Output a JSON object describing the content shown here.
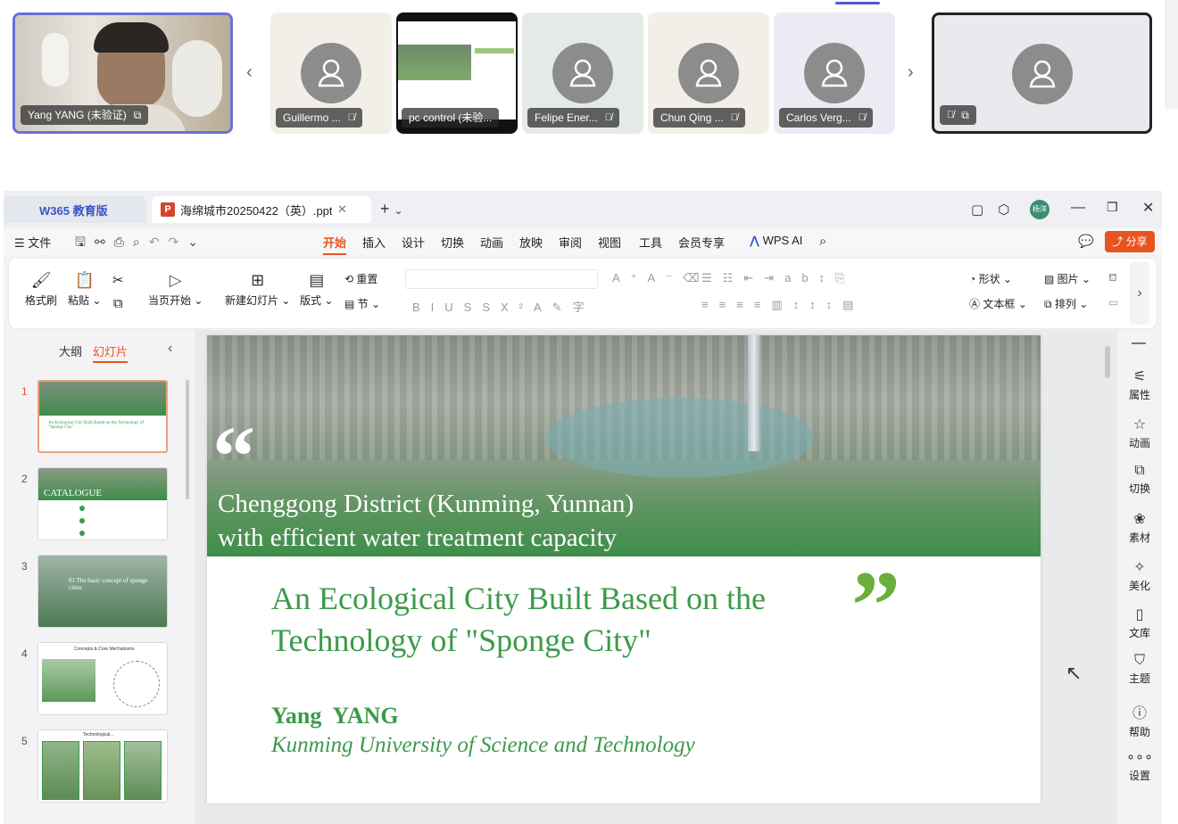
{
  "participants": [
    {
      "name": "Yang YANG (未验证)",
      "mic": "on"
    },
    {
      "name": "Guillermo ...",
      "mic": "off"
    },
    {
      "name": "pc control (未验...",
      "mic": "off"
    },
    {
      "name": "Felipe Ener...",
      "mic": "off"
    },
    {
      "name": "Chun Qing ...",
      "mic": "off"
    },
    {
      "name": "Carlos Verg...",
      "mic": "off"
    },
    {
      "name": "",
      "mic": "off"
    }
  ],
  "app": {
    "home_tab": "W365 教育版",
    "doc_tab": "海绵城市20250422（英）.ppt",
    "user_badge": "杨洋",
    "file_menu": "文件",
    "menus": [
      "开始",
      "插入",
      "设计",
      "切换",
      "动画",
      "放映",
      "审阅",
      "视图",
      "工具",
      "会员专享"
    ],
    "active_menu": "开始",
    "wps_ai": "WPS AI",
    "share": "分享"
  },
  "ribbon": {
    "format_painter": "格式刷",
    "paste": "粘贴",
    "start_current": "当页开始",
    "new_slide": "新建幻灯片",
    "layout": "版式",
    "reset": "重置",
    "section": "节",
    "shape": "形状",
    "picture": "图片",
    "textbox": "文本框",
    "arrange": "排列"
  },
  "panel": {
    "outline_tab": "大纲",
    "slides_tab": "幻灯片",
    "thumbs": [
      {
        "num": "1",
        "text": "An Ecological City Built Based on the Technology of \"Sponge City\""
      },
      {
        "num": "2",
        "text": "CATALOGUE"
      },
      {
        "num": "3",
        "text": "01 The basic concept of sponge cities"
      },
      {
        "num": "4",
        "text": "Concepts & Core Mechanisms"
      },
      {
        "num": "5",
        "text": "Technological..."
      }
    ]
  },
  "slide": {
    "banner_line1": "Chenggong District (Kunming, Yunnan)",
    "banner_line2": "with efficient water treatment capacity",
    "title_line1": "An Ecological City Built Based on the",
    "title_line2": "Technology of \"Sponge City\"",
    "author": "Yang  YANG",
    "affiliation": "Kunming University of Science and Technology"
  },
  "sidebar": [
    "属性",
    "动画",
    "切换",
    "素材",
    "美化",
    "文库",
    "主题",
    "帮助",
    "设置"
  ],
  "colors": {
    "green": "#3c9a4a",
    "accent_orange": "#e8541e"
  }
}
